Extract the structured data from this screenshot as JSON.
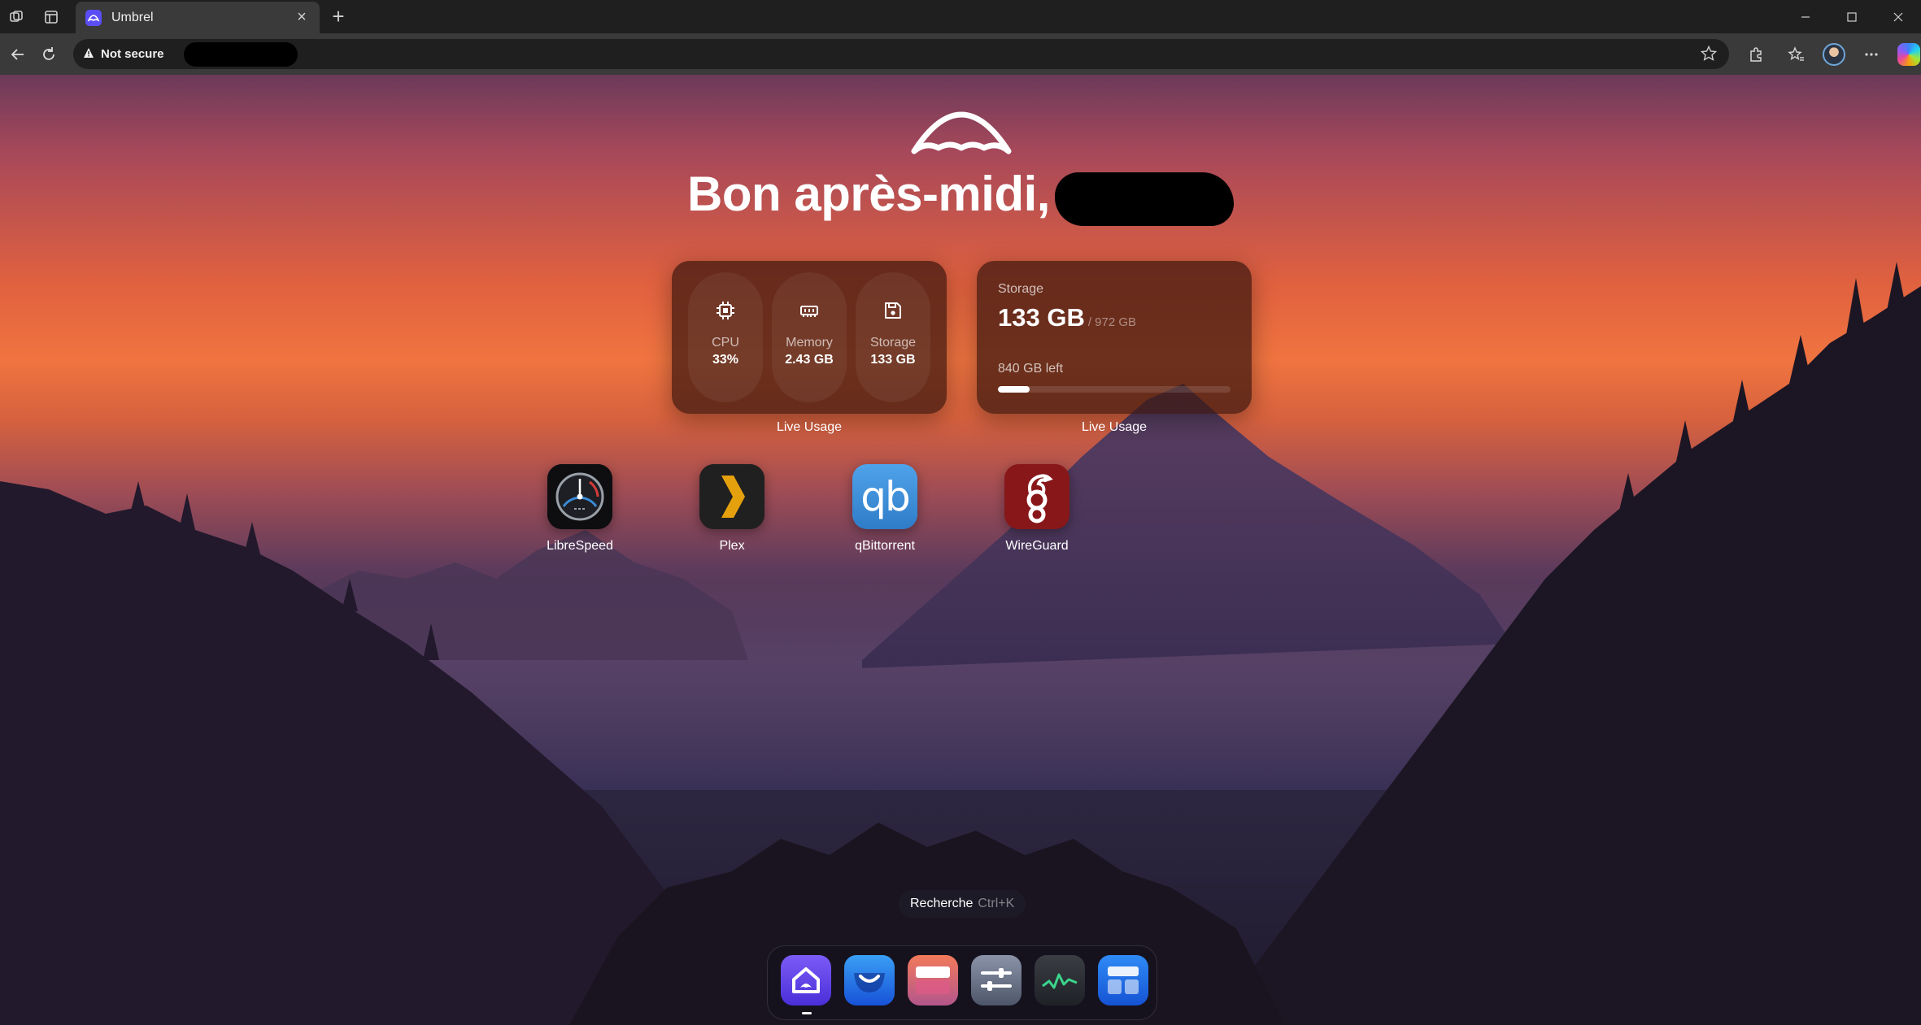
{
  "browser": {
    "tab_title": "Umbrel",
    "security_label": "Not secure",
    "tab_close": "×",
    "new_tab": "+"
  },
  "home": {
    "greeting": "Bon après-midi,"
  },
  "widgets": {
    "system": {
      "caption": "Live Usage",
      "cpu": {
        "label": "CPU",
        "value": "33%"
      },
      "memory": {
        "label": "Memory",
        "value": "2.43 GB"
      },
      "storage": {
        "label": "Storage",
        "value": "133 GB"
      }
    },
    "storage": {
      "caption": "Live Usage",
      "label": "Storage",
      "used": "133 GB",
      "total": "/ 972 GB",
      "left": "840 GB left",
      "used_fraction": 0.137
    }
  },
  "apps": [
    {
      "name": "LibreSpeed",
      "icon": "speedometer-icon"
    },
    {
      "name": "Plex",
      "icon": "plex-chevron-icon"
    },
    {
      "name": "qBittorrent",
      "icon": "qb-icon",
      "glyph": "qb"
    },
    {
      "name": "WireGuard",
      "icon": "wireguard-dragon-icon"
    }
  ],
  "search": {
    "label": "Recherche",
    "shortcut": "Ctrl+K"
  },
  "dock": [
    {
      "name": "home",
      "icon": "umbrel-home-icon"
    },
    {
      "name": "app-store",
      "icon": "app-store-icon"
    },
    {
      "name": "files",
      "icon": "files-icon"
    },
    {
      "name": "settings",
      "icon": "settings-sliders-icon"
    },
    {
      "name": "live-usage",
      "icon": "activity-chart-icon"
    },
    {
      "name": "widgets",
      "icon": "widgets-grid-icon"
    }
  ],
  "colors": {
    "accent": "#5b4ef5",
    "widget_bg": "#3a160e",
    "wireguard_red": "#88171a",
    "qb_blue": "#3d8bd6",
    "plex_yellow": "#e5a00d"
  }
}
